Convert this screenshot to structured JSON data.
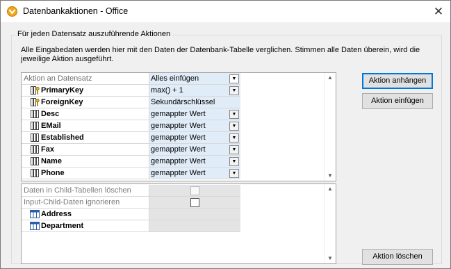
{
  "window": {
    "title": "Datenbankaktionen - Office"
  },
  "group": {
    "label": "Für jeden Datensatz auszuführende Aktionen",
    "description": "Alle Eingabedaten werden hier mit den Daten der Datenbank-Tabelle verglichen. Stimmen alle Daten überein, wird die jeweilige Aktion ausgeführt."
  },
  "actions_table": {
    "header": {
      "label": "Aktion an Datensatz",
      "value": "Alles einfügen"
    },
    "rows": [
      {
        "name": "PrimaryKey",
        "value": "max() + 1",
        "icon": "key-icon",
        "dropdown": true
      },
      {
        "name": "ForeignKey",
        "value": "Sekundärschlüssel",
        "icon": "key-icon",
        "dropdown": false
      },
      {
        "name": "Desc",
        "value": "gemappter Wert",
        "icon": "column-icon",
        "dropdown": true
      },
      {
        "name": "EMail",
        "value": "gemappter Wert",
        "icon": "column-icon",
        "dropdown": true
      },
      {
        "name": "Established",
        "value": "gemappter Wert",
        "icon": "column-icon",
        "dropdown": true
      },
      {
        "name": "Fax",
        "value": "gemappter Wert",
        "icon": "column-icon",
        "dropdown": true
      },
      {
        "name": "Name",
        "value": "gemappter Wert",
        "icon": "column-icon",
        "dropdown": true
      },
      {
        "name": "Phone",
        "value": "gemappter Wert",
        "icon": "column-icon",
        "dropdown": true
      }
    ]
  },
  "child_table": {
    "options": [
      {
        "label": "Daten in Child-Tabellen löschen",
        "checked": false,
        "enabled": false
      },
      {
        "label": "Input-Child-Daten ignorieren",
        "checked": false,
        "enabled": true
      }
    ],
    "tables": [
      {
        "name": "Address",
        "icon": "table-icon"
      },
      {
        "name": "Department",
        "icon": "table-icon"
      }
    ]
  },
  "buttons": {
    "append": "Aktion anhängen",
    "insert": "Aktion einfügen",
    "delete": "Aktion löschen"
  },
  "colors": {
    "value_cell": "#e0ecf8",
    "disabled_cell": "#e4e4e4",
    "focus": "#0078d7"
  }
}
